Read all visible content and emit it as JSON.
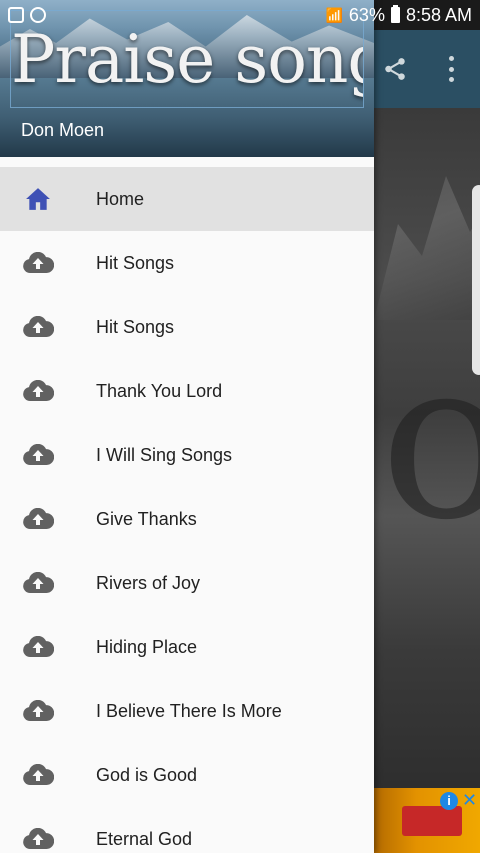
{
  "status_bar": {
    "battery": "63%",
    "time": "8:58 AM"
  },
  "drawer": {
    "header_title": "Praise songs",
    "header_subtitle": "Don Moen",
    "items": [
      {
        "label": "Home",
        "icon": "home-icon",
        "active": true
      },
      {
        "label": "Hit Songs",
        "icon": "cloud-upload-icon"
      },
      {
        "label": "Hit Songs",
        "icon": "cloud-upload-icon"
      },
      {
        "label": "Thank You Lord",
        "icon": "cloud-upload-icon"
      },
      {
        "label": "I Will Sing Songs",
        "icon": "cloud-upload-icon"
      },
      {
        "label": "Give Thanks",
        "icon": "cloud-upload-icon"
      },
      {
        "label": "Rivers of Joy",
        "icon": "cloud-upload-icon"
      },
      {
        "label": "Hiding Place",
        "icon": "cloud-upload-icon"
      },
      {
        "label": "I Believe There Is More",
        "icon": "cloud-upload-icon"
      },
      {
        "label": "God is Good",
        "icon": "cloud-upload-icon"
      },
      {
        "label": "Eternal God",
        "icon": "cloud-upload-icon"
      }
    ]
  },
  "colors": {
    "toolbar": "#2b4f63",
    "active_icon": "#3f51b5",
    "icon_gray": "#616161",
    "active_row": "#e1e1e1"
  }
}
